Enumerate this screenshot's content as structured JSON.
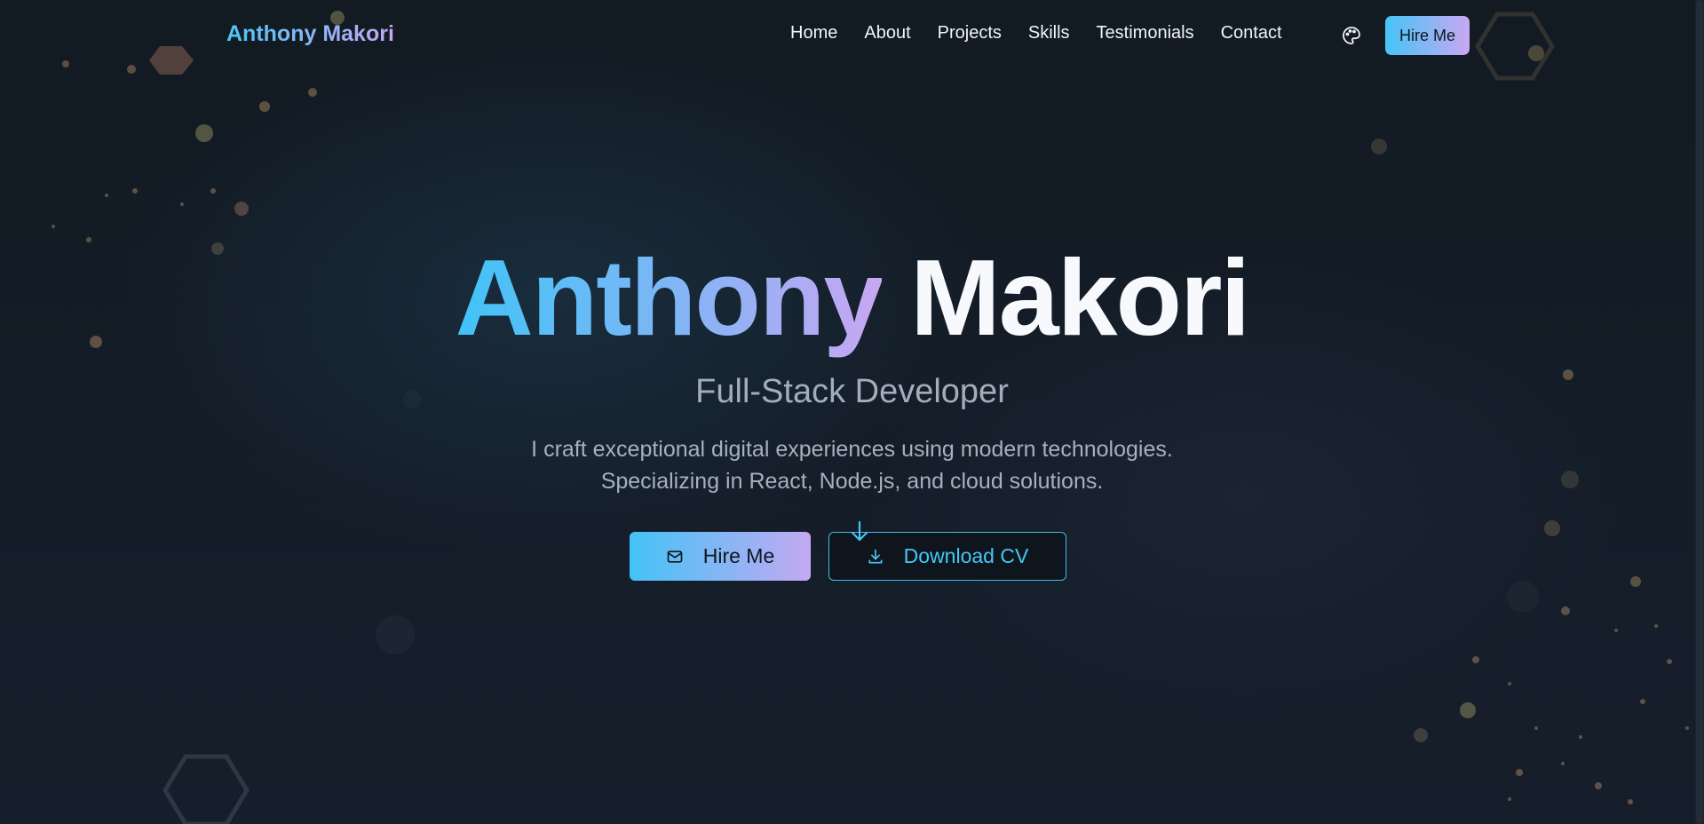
{
  "nav": {
    "brand": "Anthony Makori",
    "links": [
      "Home",
      "About",
      "Projects",
      "Skills",
      "Testimonials",
      "Contact"
    ],
    "theme_icon": "palette-icon",
    "hire_label": "Hire Me"
  },
  "hero": {
    "first_name": "Anthony",
    "last_name": "Makori",
    "subtitle": "Full-Stack Developer",
    "desc_line1": "I craft exceptional digital experiences using modern technologies.",
    "desc_line2": "Specializing in React, Node.js, and cloud solutions.",
    "hire_button": "Hire Me",
    "hire_icon": "mail-icon",
    "cv_button": "Download CV",
    "cv_icon": "download-icon"
  },
  "colors": {
    "background": "#111922",
    "accent_cyan": "#43c3f6",
    "accent_purple": "#c4a9f2",
    "text_muted": "#a3adbb"
  }
}
